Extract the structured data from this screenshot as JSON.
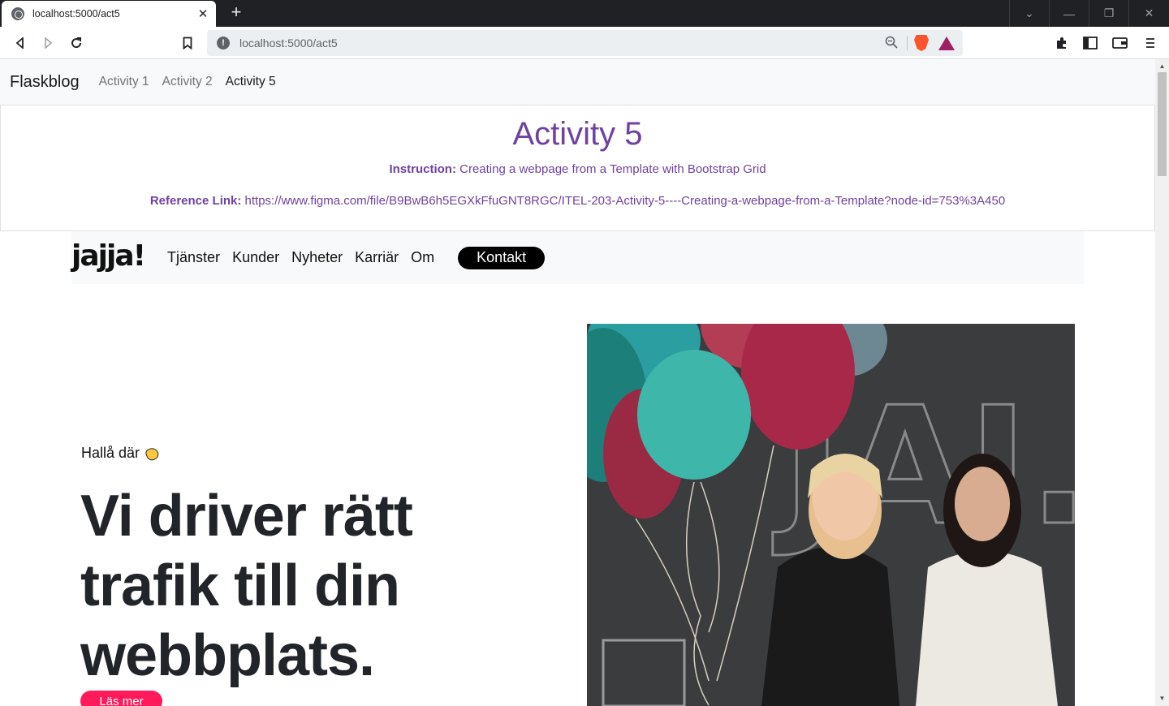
{
  "browser": {
    "tab_title": "localhost:5000/act5",
    "tab_close": "✕",
    "new_tab": "+",
    "url": "localhost:5000/act5",
    "window_controls": [
      "⌄",
      "—",
      "❐",
      "✕"
    ]
  },
  "flask_nav": {
    "brand": "Flaskblog",
    "links": [
      "Activity 1",
      "Activity 2",
      "Activity 5"
    ]
  },
  "header": {
    "title": "Activity 5",
    "instruction_label": "Instruction:",
    "instruction_text": " Creating a webpage from a Template with Bootstrap Grid",
    "reference_label": "Reference Link:",
    "reference_url": " https://www.figma.com/file/B9BwB6h5EGXkFfuGNT8RGC/ITEL-203-Activity-5----Creating-a-webpage-from-a-Template?node-id=753%3A450"
  },
  "site_nav": {
    "logo": "jajja!",
    "links": [
      "Tjänster",
      "Kunder",
      "Nyheter",
      "Karriär",
      "Om"
    ],
    "cta": "Kontakt"
  },
  "hero": {
    "greeting": "Hallå där",
    "headline_lines": [
      "Vi driver rätt",
      "trafik till din",
      "webbplats."
    ],
    "button": "Läs mer",
    "photo_wall_text": "JAJ."
  },
  "colors": {
    "accent_purple": "#6f42a0",
    "cta_pink": "#ff1a5c",
    "balloon_teal": "#3fb6aa",
    "balloon_red": "#b52a4a"
  }
}
